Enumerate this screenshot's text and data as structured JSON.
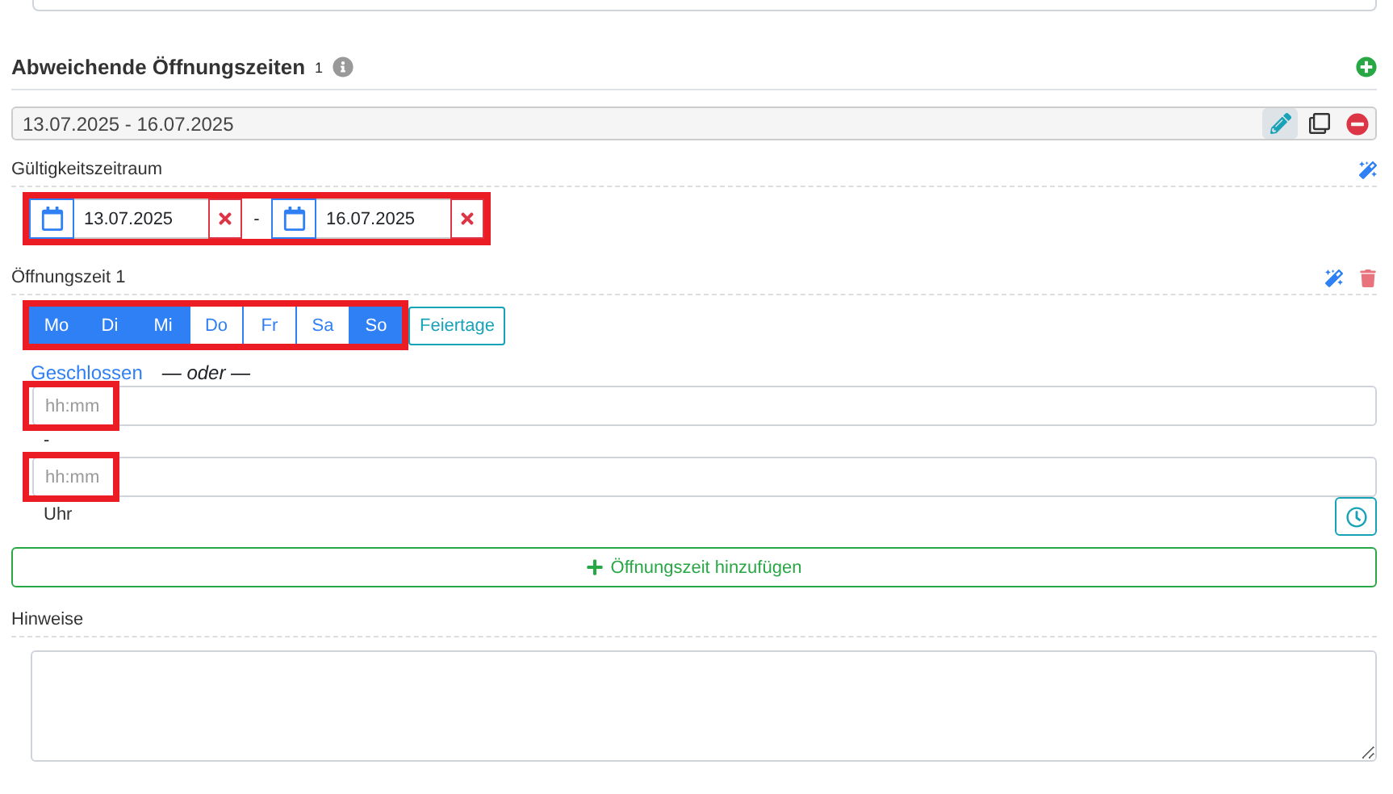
{
  "section": {
    "title": "Abweichende Öffnungszeiten",
    "count": "1"
  },
  "period": {
    "value": "13.07.2025 - 16.07.2025",
    "editing": true
  },
  "validity": {
    "label": "Gültigkeitszeitraum",
    "from": "13.07.2025",
    "separator": "-",
    "to": "16.07.2025",
    "highlighted": true
  },
  "opening": {
    "label": "Öffnungszeit 1",
    "days_highlighted": true,
    "days": [
      {
        "label": "Mo",
        "selected": true
      },
      {
        "label": "Di",
        "selected": true
      },
      {
        "label": "Mi",
        "selected": true
      },
      {
        "label": "Do",
        "selected": false
      },
      {
        "label": "Fr",
        "selected": false
      },
      {
        "label": "Sa",
        "selected": false
      },
      {
        "label": "So",
        "selected": true
      }
    ],
    "holiday": "Feiertage",
    "closed_link": "Geschlossen",
    "or_text": "— oder —",
    "from": {
      "placeholder": "hh:mm",
      "highlighted": true
    },
    "range_separator": "-",
    "to": {
      "placeholder": "hh:mm",
      "highlighted": true
    },
    "unit": "Uhr"
  },
  "add_button": "Öffnungszeit hinzufügen",
  "notes": {
    "label": "Hinweise"
  }
}
